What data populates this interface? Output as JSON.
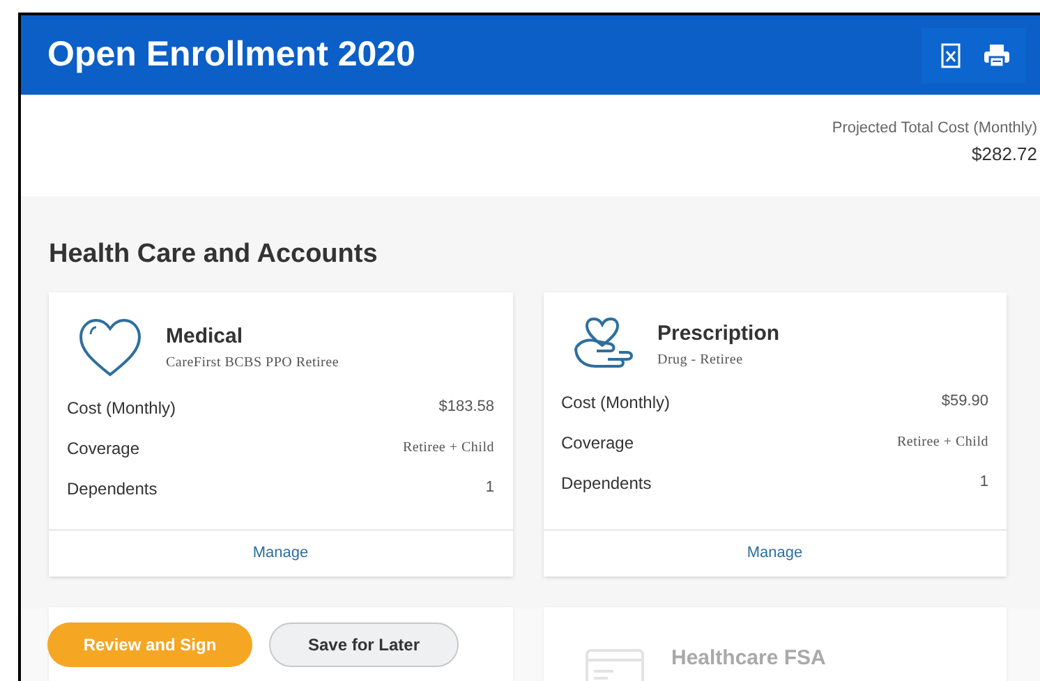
{
  "header": {
    "title": "Open Enrollment 2020",
    "actions": [
      {
        "kind": "excel"
      },
      {
        "kind": "print"
      }
    ]
  },
  "summary": {
    "label": "Projected Total Cost (Monthly)",
    "value": "$282.72"
  },
  "section": {
    "title": "Health Care and Accounts",
    "cards": [
      {
        "kind": "medical",
        "title": "Medical",
        "subtitle": "CareFirst BCBS PPO Retiree",
        "rows": [
          {
            "label": "Cost (Monthly)",
            "value": "$183.58"
          },
          {
            "label": "Coverage",
            "value": "Retiree + Child"
          },
          {
            "label": "Dependents",
            "value": "1"
          }
        ],
        "action": "Manage"
      },
      {
        "kind": "prescription",
        "title": "Prescription",
        "subtitle": "Drug - Retiree",
        "rows": [
          {
            "label": "Cost (Monthly)",
            "value": "$59.90"
          },
          {
            "label": "Coverage",
            "value": "Retiree + Child"
          },
          {
            "label": "Dependents",
            "value": "1"
          }
        ],
        "action": "Manage"
      }
    ],
    "partial_cards": [
      {
        "kind": "blank"
      },
      {
        "kind": "fsa",
        "title": "Healthcare FSA"
      }
    ]
  },
  "footer": {
    "buttons": [
      {
        "label": "Review and Sign",
        "kind": "primary"
      },
      {
        "label": "Save for Later",
        "kind": "secondary"
      }
    ]
  }
}
